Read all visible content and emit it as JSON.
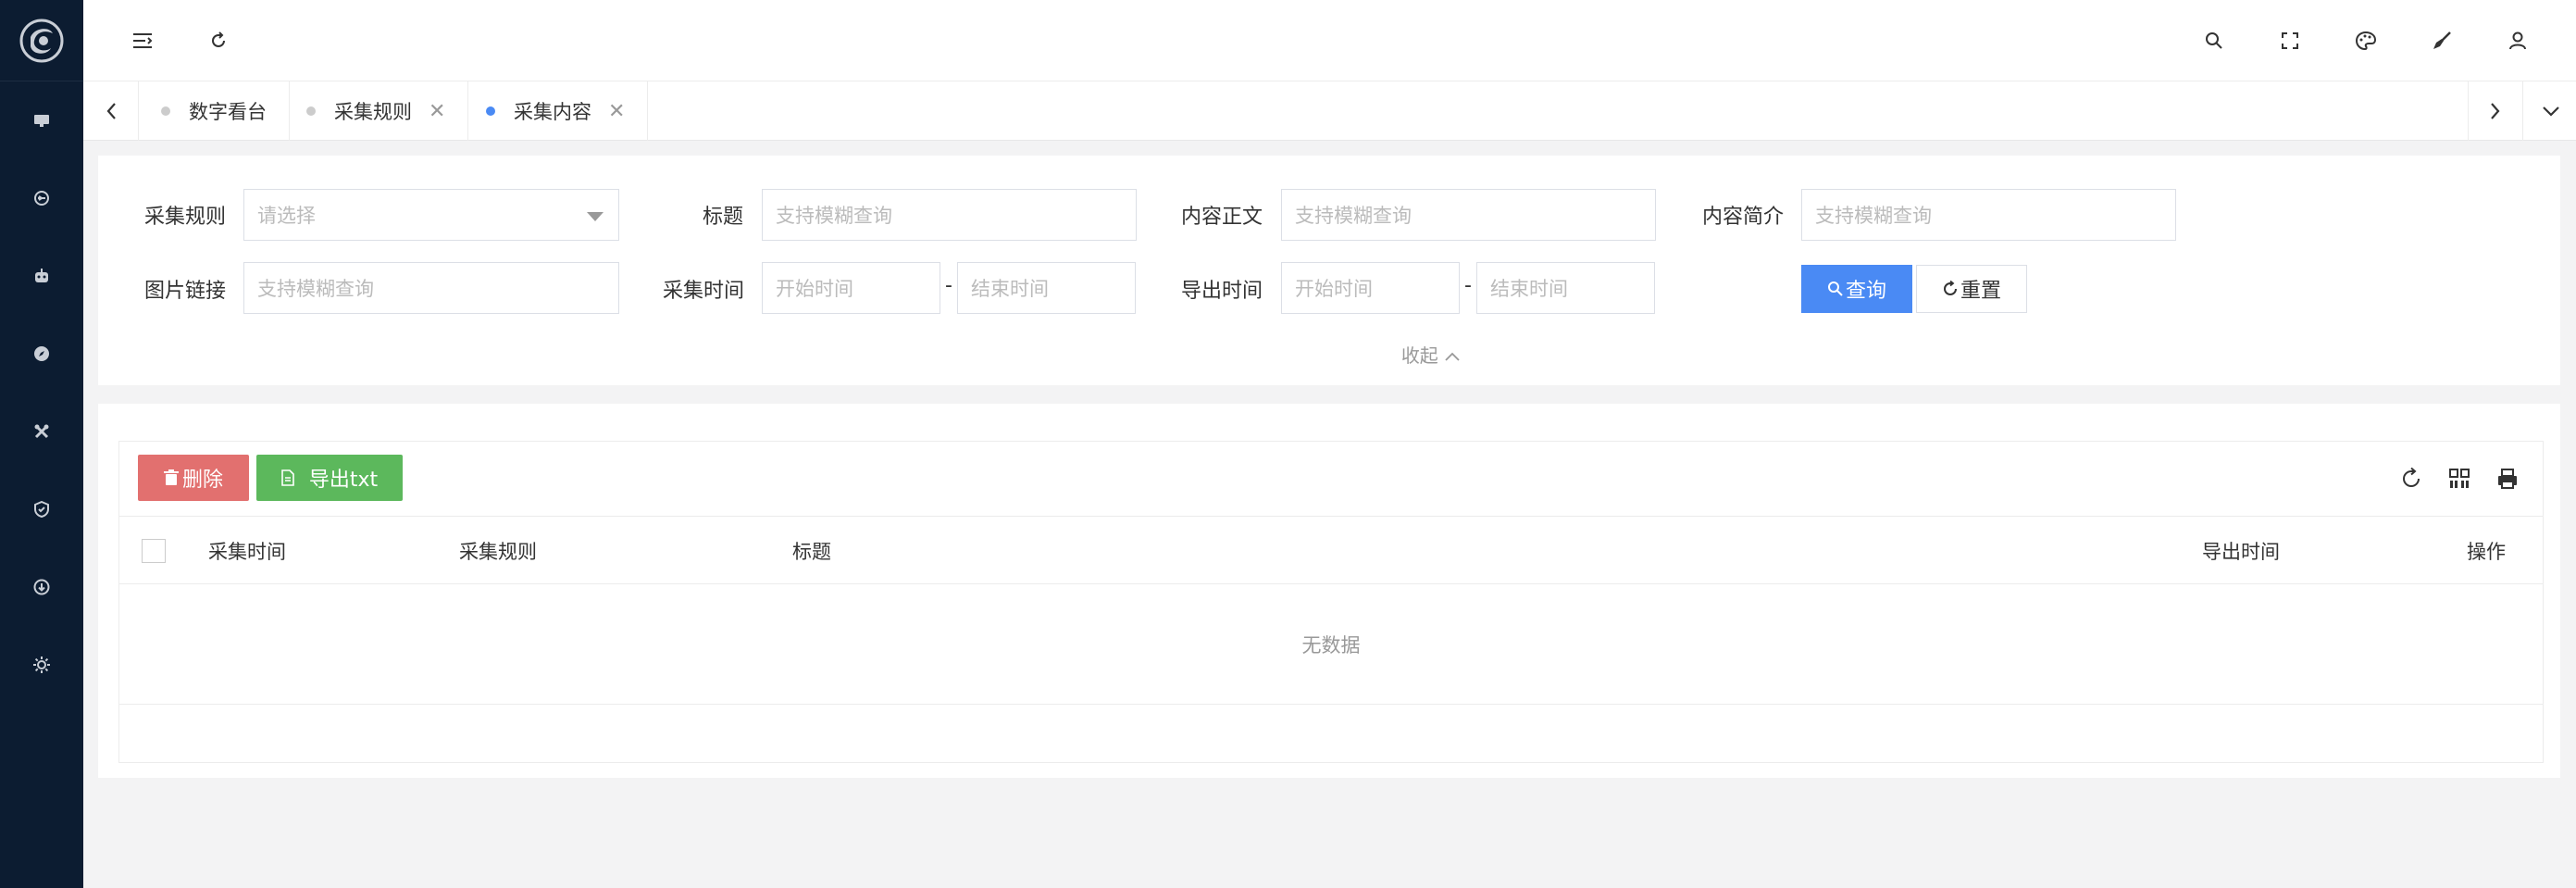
{
  "tabs": [
    {
      "label": "数字看台",
      "closable": false,
      "active": false
    },
    {
      "label": "采集规则",
      "closable": true,
      "active": false
    },
    {
      "label": "采集内容",
      "closable": true,
      "active": true
    }
  ],
  "search": {
    "rule_label": "采集规则",
    "rule_placeholder": "请选择",
    "title_label": "标题",
    "title_placeholder": "支持模糊查询",
    "body_label": "内容正文",
    "body_placeholder": "支持模糊查询",
    "summary_label": "内容简介",
    "summary_placeholder": "支持模糊查询",
    "image_label": "图片链接",
    "image_placeholder": "支持模糊查询",
    "collect_time_label": "采集时间",
    "collect_start_placeholder": "开始时间",
    "collect_end_placeholder": "结束时间",
    "export_time_label": "导出时间",
    "export_start_placeholder": "开始时间",
    "export_end_placeholder": "结束时间",
    "range_separator": "-",
    "query_label": "查询",
    "reset_label": "重置",
    "collapse_label": "收起"
  },
  "toolbar": {
    "delete_label": "删除",
    "export_label": "导出txt"
  },
  "table": {
    "columns": [
      "采集时间",
      "采集规则",
      "标题",
      "导出时间",
      "操作"
    ],
    "empty_text": "无数据"
  },
  "colors": {
    "sidebar": "#0c1c31",
    "primary": "#4a8af4",
    "danger": "#e2706f",
    "success": "#5cb85c"
  }
}
